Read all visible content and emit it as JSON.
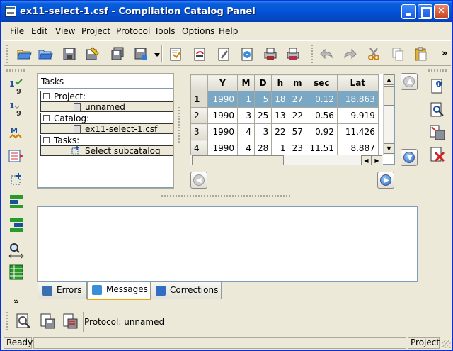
{
  "window": {
    "title": "ex11-select-1.csf - Compilation Catalog Panel"
  },
  "menu": [
    "File",
    "Edit",
    "View",
    "Project",
    "Protocol",
    "Tools",
    "Options",
    "Help"
  ],
  "toolbar": {
    "overflow_label": "»"
  },
  "tasks": {
    "header": "Tasks",
    "project_label": "Project:",
    "project_value": "unnamed",
    "catalog_label": "Catalog:",
    "catalog_value": "ex11-select-1.csf",
    "tasks_label": "Tasks:",
    "task_value": "Select subcatalog"
  },
  "table": {
    "columns": [
      "",
      "Y",
      "M",
      "D",
      "h",
      "m",
      "sec",
      "Lat"
    ],
    "rows": [
      [
        "1",
        "1990",
        "1",
        "5",
        "18",
        "27",
        "0.12",
        "18.863"
      ],
      [
        "2",
        "1990",
        "3",
        "25",
        "13",
        "22",
        "0.56",
        "9.919"
      ],
      [
        "3",
        "1990",
        "4",
        "3",
        "22",
        "57",
        "0.92",
        "11.426"
      ],
      [
        "4",
        "1990",
        "4",
        "28",
        "1",
        "23",
        "11.51",
        "8.887"
      ]
    ],
    "selected_row": 0
  },
  "tabs": [
    {
      "label": "Errors",
      "active": false,
      "color": "#3a6fb0"
    },
    {
      "label": "Messages",
      "active": true,
      "color": "#3b8fd8"
    },
    {
      "label": "Corrections",
      "active": false,
      "color": "#2f6ec4"
    }
  ],
  "protocol": {
    "label": "Protocol: unnamed"
  },
  "status": {
    "left": "Ready",
    "right": "Project"
  },
  "colors": {
    "title_bar": "#0453d8",
    "selection": "#7aa7c3",
    "window_bg": "#ece9d8"
  },
  "icons": {
    "toolbar": [
      "open-folder-icon",
      "open-file-icon",
      "save-icon",
      "edit-save-icon",
      "save-all-icon",
      "save-as-icon",
      "dropdown-icon",
      "new-page-icon",
      "open-page-icon",
      "edit-page-icon",
      "refresh-page-icon",
      "print-icon",
      "print-preview-icon",
      "undo-icon",
      "redo-icon",
      "cut-icon",
      "copy-icon",
      "paste-icon"
    ],
    "left": [
      "sort-ascending-icon",
      "sort-descending-icon",
      "magnitude-icon",
      "filter-list-icon",
      "select-region-icon",
      "split-icon",
      "merge-icon",
      "zoom-arrows-icon",
      "table-icon",
      "more-icon"
    ],
    "right": [
      "info-icon",
      "inspect-icon",
      "save-db-icon",
      "delete-icon"
    ]
  }
}
